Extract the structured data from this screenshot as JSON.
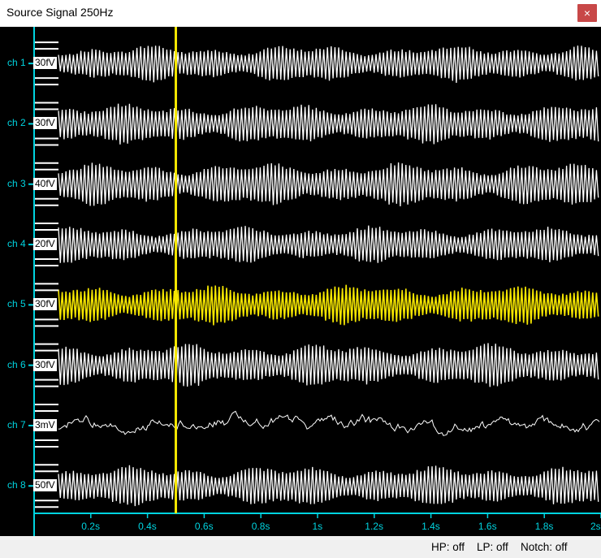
{
  "window": {
    "title": "Source Signal 250Hz",
    "close_glyph": "×"
  },
  "channels": [
    {
      "label": "ch 1",
      "scale": "30fV"
    },
    {
      "label": "ch 2",
      "scale": "30fV"
    },
    {
      "label": "ch 3",
      "scale": "40fV"
    },
    {
      "label": "ch 4",
      "scale": "20fV"
    },
    {
      "label": "ch 5",
      "scale": "30fV",
      "highlighted": true
    },
    {
      "label": "ch 6",
      "scale": "30fV"
    },
    {
      "label": "ch 7",
      "scale": "3mV"
    },
    {
      "label": "ch 8",
      "scale": "50fV"
    }
  ],
  "time_axis": {
    "unit": "s",
    "range": [
      0,
      2
    ],
    "ticks": [
      "0.2s",
      "0.4s",
      "0.6s",
      "0.8s",
      "1s",
      "1.2s",
      "1.4s",
      "1.6s",
      "1.8s",
      "2s"
    ]
  },
  "cursor": {
    "time_s": 0.5,
    "color": "#f5e600"
  },
  "colors": {
    "background": "#000000",
    "trace": "#ffffff",
    "highlight_trace": "#f5e600",
    "axis": "#00d4e0"
  },
  "status": {
    "hp": "HP: off",
    "lp": "LP: off",
    "notch": "Notch: off"
  }
}
